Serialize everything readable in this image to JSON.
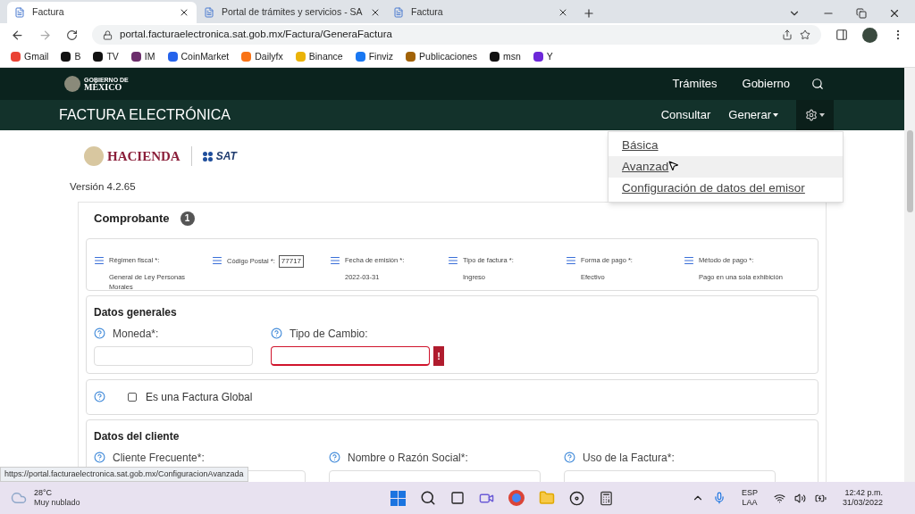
{
  "browser": {
    "tabs": [
      {
        "title": "Factura",
        "selected": true
      },
      {
        "title": "Portal de trámites y servicios - SA",
        "selected": false
      },
      {
        "title": "Factura",
        "selected": false
      }
    ],
    "url": "portal.facturaelectronica.sat.gob.mx/Factura/GeneraFactura",
    "bookmarks": [
      "Gmail",
      "B",
      "TV",
      "IM",
      "CoinMarket",
      "Dailyfx",
      "Binance",
      "Finviz",
      "Publicaciones",
      "msn",
      "Y"
    ],
    "status_url": "https://portal.facturaelectronica.sat.gob.mx/ConfiguracionAvanzada"
  },
  "gov_header": {
    "brand_top": "GOBIERNO DE",
    "brand": "MÉXICO",
    "nav": [
      "Trámites",
      "Gobierno"
    ]
  },
  "app_bar": {
    "title": "FACTURA ELECTRÓNICA",
    "nav": [
      {
        "label": "Consultar",
        "kind": "link"
      },
      {
        "label": "Generar",
        "kind": "dropdown"
      }
    ],
    "settings_menu": {
      "open": true,
      "items": [
        {
          "label": "Básica",
          "hovered": false
        },
        {
          "label": "Avanzad",
          "hovered": true
        },
        {
          "label": "Configuración de datos del emisor",
          "hovered": false
        }
      ]
    }
  },
  "logos": {
    "hacienda": "HACIENDA",
    "sat": "SAT"
  },
  "version": "Versión 4.2.65",
  "comprobante": {
    "title": "Comprobante",
    "badge": "1",
    "fields": [
      {
        "label": "Régimen fiscal *:",
        "value": "General de Ley Personas Morales",
        "kind": "text"
      },
      {
        "label": "Código Postal *:",
        "value": "77717",
        "kind": "input"
      },
      {
        "label": "Fecha de emisión *:",
        "value": "2022-03-31",
        "kind": "text"
      },
      {
        "label": "Tipo de factura *:",
        "value": "Ingreso",
        "kind": "text"
      },
      {
        "label": "Forma de pago *:",
        "value": "Efectivo",
        "kind": "text"
      },
      {
        "label": "Método de pago *:",
        "value": "Pago en una sola exhibición",
        "kind": "text"
      }
    ]
  },
  "datos_generales": {
    "title": "Datos generales",
    "fields": [
      {
        "label": "Moneda*:",
        "error": false
      },
      {
        "label": "Tipo de Cambio:",
        "error": true
      }
    ],
    "error_mark": "!"
  },
  "factura_global": {
    "label": "Es una Factura Global",
    "checked": false
  },
  "datos_cliente": {
    "title": "Datos del cliente",
    "fields": [
      {
        "label": "Cliente Frecuente*:"
      },
      {
        "label": "Nombre o Razón Social*:"
      },
      {
        "label": "Uso de la Factura*:"
      }
    ]
  },
  "taskbar": {
    "temperature": "28°C",
    "weather": "Muy nublado",
    "lang_top": "ESP",
    "lang_bottom": "LAA",
    "time": "12:42 p.m.",
    "date": "31/03/2022"
  }
}
